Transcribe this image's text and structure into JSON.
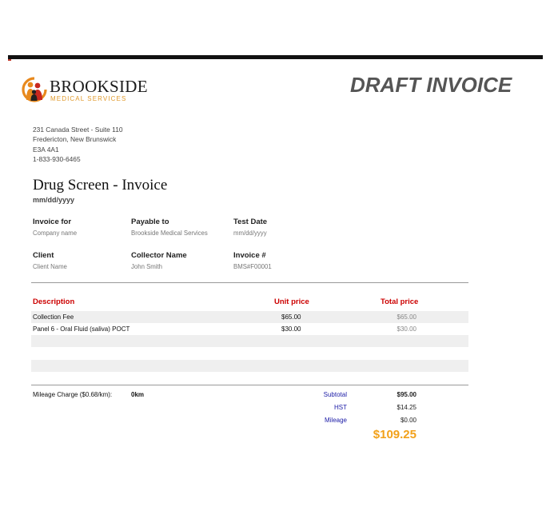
{
  "logo": {
    "name": "BROOKSIDE",
    "subtitle": "MEDICAL SERVICES",
    "colors": {
      "orange": "#e8891d",
      "red": "#c8281f",
      "dark": "#222222"
    }
  },
  "heading": {
    "draft": "DRAFT INVOICE"
  },
  "address": {
    "line1": "231 Canada Street - Suite 110",
    "line2": "Fredericton, New Brunswick",
    "line3": "E3A 4A1",
    "phone": "1-833-930-6465"
  },
  "document": {
    "title": "Drug Screen - Invoice",
    "date": "mm/dd/yyyy"
  },
  "fields": {
    "invoice_for": {
      "label": "Invoice for",
      "value": "Company name"
    },
    "payable_to": {
      "label": "Payable to",
      "value": "Brookside Medical Services"
    },
    "test_date": {
      "label": "Test Date",
      "value": "mm/dd/yyyy"
    },
    "client": {
      "label": "Client",
      "value": "Client Name"
    },
    "collector": {
      "label": "Collector Name",
      "value": "John Smith"
    },
    "invoice_no": {
      "label": "Invoice #",
      "value": "BMS#F00001"
    }
  },
  "table": {
    "headers": {
      "description": "Description",
      "unit_price": "Unit price",
      "total_price": "Total price"
    },
    "rows": [
      {
        "description": "Collection Fee",
        "unit_price": "$65.00",
        "total_price": "$65.00"
      },
      {
        "description": "Panel 6 - Oral Fluid (saliva) POCT",
        "unit_price": "$30.00",
        "total_price": "$30.00"
      },
      {
        "description": "",
        "unit_price": "",
        "total_price": ""
      },
      {
        "description": "",
        "unit_price": "",
        "total_price": ""
      },
      {
        "description": "",
        "unit_price": "",
        "total_price": ""
      },
      {
        "description": "",
        "unit_price": "",
        "total_price": ""
      }
    ]
  },
  "mileage": {
    "label": "Mileage Charge ($0.68/km):",
    "value": "0km"
  },
  "summary": {
    "subtotal": {
      "label": "Subtotal",
      "value": "$95.00"
    },
    "hst": {
      "label": "HST",
      "value": "$14.25"
    },
    "mileage": {
      "label": "Mileage",
      "value": "$0.00"
    },
    "total": "$109.25"
  },
  "colors": {
    "header_red": "#cc0000",
    "summary_blue": "#1a1aa6",
    "total_orange": "#f2a11a",
    "draft_gray": "#555555",
    "row_shade": "#efefef"
  }
}
